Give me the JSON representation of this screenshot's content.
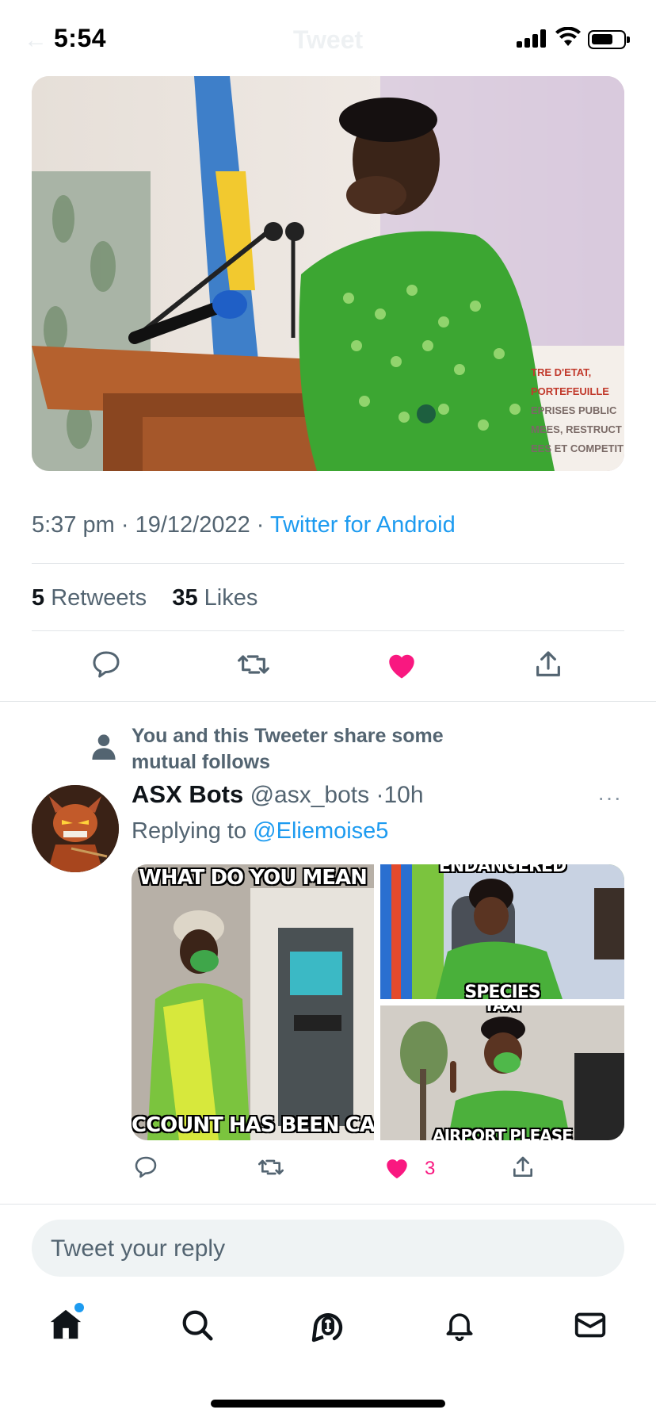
{
  "status_bar": {
    "time": "5:54"
  },
  "nav": {
    "title": "Tweet",
    "back": "←"
  },
  "tweet": {
    "time": "5:37 pm",
    "date": "19/12/2022",
    "source": "Twitter for Android",
    "retweets_count": "5",
    "retweets_label": "Retweets",
    "likes_count": "35",
    "likes_label": "Likes",
    "banner_text": [
      "TRE D'ETAT,",
      "PORTEFEUILLE",
      "EPRISES PUBLIC",
      "MEES, RESTRUCT",
      "EES ET COMPETIT"
    ]
  },
  "reply": {
    "mutual_text": "You and this Tweeter share some mutual follows",
    "name": "ASX Bots",
    "handle": "@asx_bots",
    "time": "10h",
    "replying_prefix": "Replying to",
    "replying_handle": "@Eliemoise5",
    "more": "···",
    "like_count": "3",
    "memes": {
      "img1_top": "WHAT DO YOU MEAN",
      "img1_bottom": "CCOUNT HAS BEEN CANCE",
      "img2_top": "ENDANGERED",
      "img2_bottom": "SPECIES",
      "img3_top": "TAXI",
      "img3_bottom": "AIRPORT PLEASE"
    }
  },
  "reply_box": {
    "placeholder": "Tweet your reply"
  },
  "colors": {
    "accent": "#1d9bf0",
    "like": "#f91880",
    "muted": "#536471"
  }
}
